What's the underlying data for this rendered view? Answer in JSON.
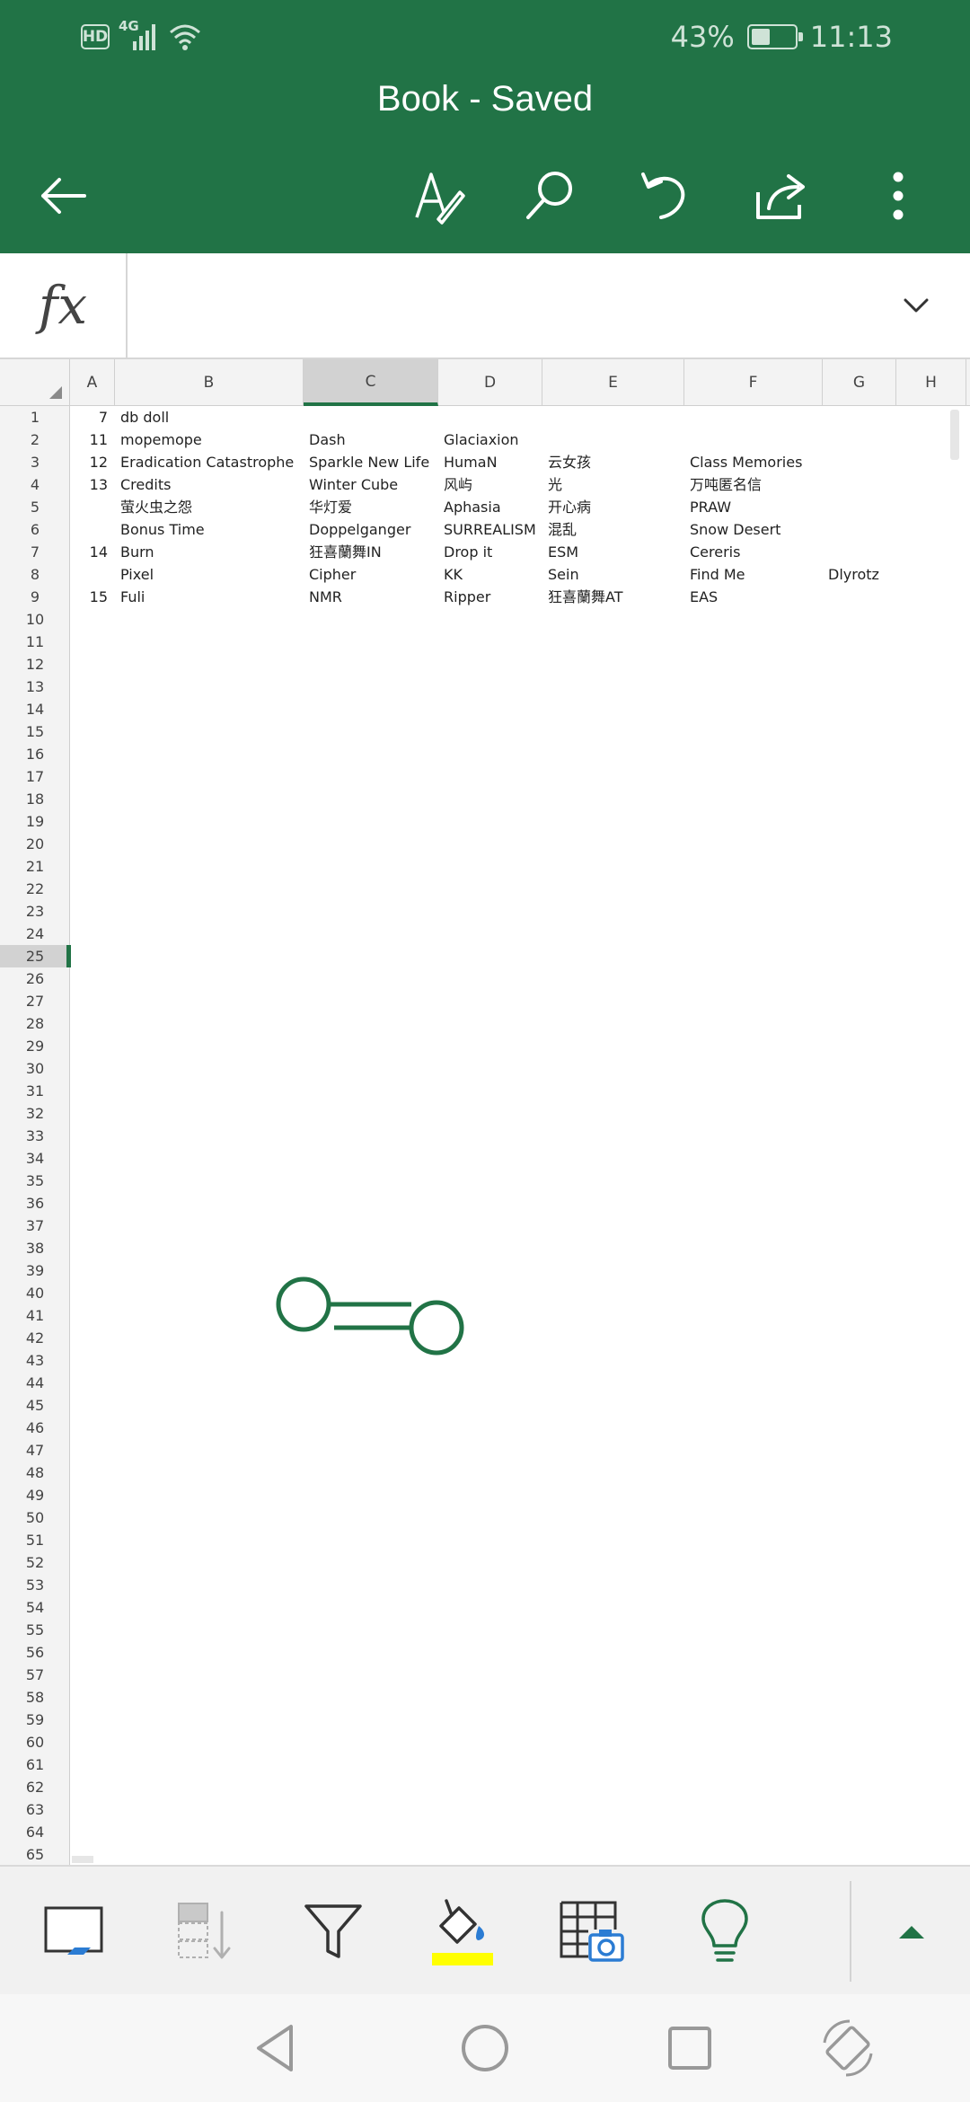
{
  "status_bar": {
    "left": {
      "hd": "HD",
      "network": "4G"
    },
    "right": {
      "battery_text": "43%",
      "battery_level": 0.43,
      "time": "11:13"
    }
  },
  "header": {
    "title": "Book - Saved",
    "icons": [
      "back-arrow-icon",
      "draw-pen-icon",
      "search-icon",
      "undo-icon",
      "share-icon",
      "more-vertical-icon"
    ],
    "accent_color": "#217346"
  },
  "formula_bar": {
    "label": "fx",
    "value": ""
  },
  "grid": {
    "columns": [
      "A",
      "B",
      "C",
      "D",
      "E",
      "F",
      "G",
      "H"
    ],
    "selected_column": "C",
    "row_numbers": [
      "1",
      "2",
      "3",
      "4",
      "5",
      "6",
      "7",
      "8",
      "9",
      "10",
      "11",
      "12",
      "13",
      "14",
      "15",
      "16",
      "17",
      "18",
      "19",
      "20",
      "21",
      "22",
      "23",
      "24",
      "25",
      "26",
      "27",
      "28",
      "29",
      "30",
      "31",
      "32",
      "33",
      "34",
      "35",
      "36",
      "37",
      "38",
      "39",
      "40",
      "41",
      "42",
      "43",
      "44",
      "45",
      "46",
      "47",
      "48",
      "49",
      "50",
      "51",
      "52",
      "53",
      "54",
      "55",
      "56",
      "57",
      "58",
      "59",
      "60",
      "61",
      "62",
      "63",
      "64",
      "65"
    ],
    "selected_row": "25",
    "rows": [
      {
        "A": "7",
        "B": "db doll",
        "C": "",
        "D": "",
        "E": "",
        "F": "",
        "G": ""
      },
      {
        "A": "11",
        "B": "mopemope",
        "C": "Dash",
        "D": "Glaciaxion",
        "E": "",
        "F": "",
        "G": ""
      },
      {
        "A": "12",
        "B": "Eradication Catastrophe",
        "C": "Sparkle New Life",
        "D": "HumaN",
        "E": "云女孩",
        "F": "Class Memories",
        "G": ""
      },
      {
        "A": "13",
        "B": "Credits",
        "C": "Winter Cube",
        "D": "风屿",
        "E": "光",
        "F": "万吨匿名信",
        "G": ""
      },
      {
        "A": "",
        "B": "萤火虫之怨",
        "C": "华灯爱",
        "D": "Aphasia",
        "E": "开心病",
        "F": "PRAW",
        "G": ""
      },
      {
        "A": "",
        "B": "Bonus Time",
        "C": "Doppelganger",
        "D": "SURREALISM",
        "E": "混乱",
        "F": "Snow Desert",
        "G": ""
      },
      {
        "A": "14",
        "B": "Burn",
        "C": "狂喜蘭舞IN",
        "D": "Drop it",
        "E": "ESM",
        "F": "Cereris",
        "G": ""
      },
      {
        "A": "",
        "B": "Pixel",
        "C": "Cipher",
        "D": "KK",
        "E": "Sein",
        "F": "Find Me",
        "G": "Dlyrotz"
      },
      {
        "A": "15",
        "B": "Fuli",
        "C": "NMR",
        "D": "Ripper",
        "E": "狂喜蘭舞AT",
        "F": "EAS",
        "G": ""
      }
    ]
  },
  "ribbon": {
    "icons": [
      "shape-fill-icon",
      "insert-cells-icon",
      "filter-icon",
      "fill-color-icon",
      "insert-picture-table-icon",
      "lightbulb-icon",
      "expand-up-icon"
    ],
    "fill_color": "#ffff00"
  },
  "system_nav": {
    "icons": [
      "back-triangle-icon",
      "home-circle-icon",
      "recents-square-icon",
      "rotate-screen-icon"
    ]
  }
}
